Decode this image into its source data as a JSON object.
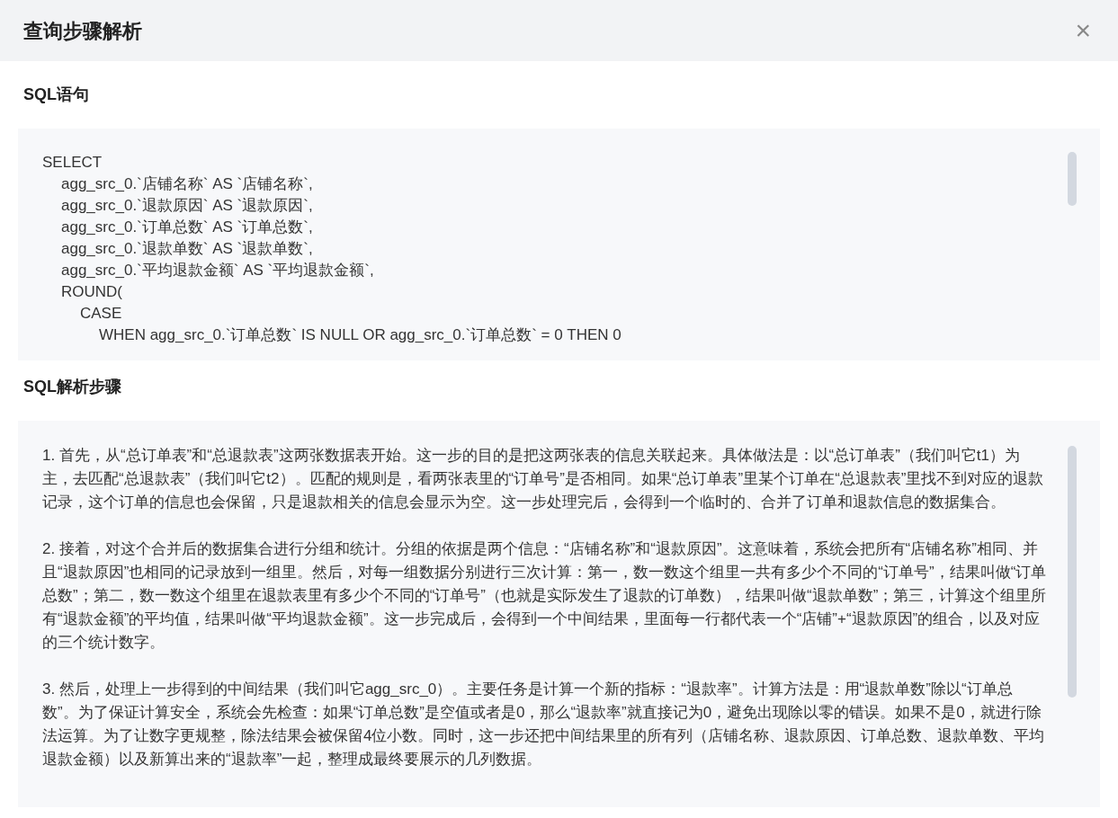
{
  "dialog": {
    "title": "查询步骤解析",
    "close": "×"
  },
  "sql_section": {
    "heading": "SQL语句",
    "code": [
      {
        "text": "SELECT",
        "children": [
          {
            "text": "agg_src_0.`店铺名称` AS `店铺名称`,"
          },
          {
            "text": "agg_src_0.`退款原因` AS `退款原因`,"
          },
          {
            "text": "agg_src_0.`订单总数` AS `订单总数`,"
          },
          {
            "text": "agg_src_0.`退款单数` AS `退款单数`,"
          },
          {
            "text": "agg_src_0.`平均退款金额` AS `平均退款金额`,"
          },
          {
            "text": "ROUND(",
            "children": [
              {
                "text": "CASE",
                "children": [
                  {
                    "text": "WHEN agg_src_0.`订单总数` IS NULL OR agg_src_0.`订单总数` = 0 THEN 0"
                  }
                ]
              }
            ]
          }
        ]
      }
    ]
  },
  "steps_section": {
    "heading": "SQL解析步骤",
    "paragraphs": [
      "1. 首先，从“总订单表”和“总退款表”这两张数据表开始。这一步的目的是把这两张表的信息关联起来。具体做法是：以“总订单表”（我们叫它t1）为主，去匹配“总退款表”（我们叫它t2）。匹配的规则是，看两张表里的“订单号”是否相同。如果“总订单表”里某个订单在“总退款表”里找不到对应的退款记录，这个订单的信息也会保留，只是退款相关的信息会显示为空。这一步处理完后，会得到一个临时的、合并了订单和退款信息的数据集合。",
      "2. 接着，对这个合并后的数据集合进行分组和统计。分组的依据是两个信息：“店铺名称”和“退款原因”。这意味着，系统会把所有“店铺名称”相同、并且“退款原因”也相同的记录放到一组里。然后，对每一组数据分别进行三次计算：第一，数一数这个组里一共有多少个不同的“订单号”，结果叫做“订单总数”；第二，数一数这个组里在退款表里有多少个不同的“订单号”（也就是实际发生了退款的订单数），结果叫做“退款单数”；第三，计算这个组里所有“退款金额”的平均值，结果叫做“平均退款金额”。这一步完成后，会得到一个中间结果，里面每一行都代表一个“店铺”+“退款原因”的组合，以及对应的三个统计数字。",
      "3. 然后，处理上一步得到的中间结果（我们叫它agg_src_0）。主要任务是计算一个新的指标：“退款率”。计算方法是：用“退款单数”除以“订单总数”。为了保证计算安全，系统会先检查：如果“订单总数”是空值或者是0，那么“退款率”就直接记为0，避免出现除以零的错误。如果不是0，就进行除法运算。为了让数字更规整，除法结果会被保留4位小数。同时，这一步还把中间结果里的所有列（店铺名称、退款原因、订单总数、退款单数、平均退款金额）以及新算出来的“退款率”一起，整理成最终要展示的几列数据。"
    ]
  }
}
